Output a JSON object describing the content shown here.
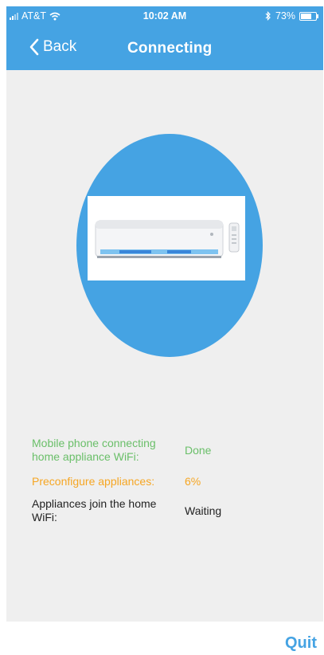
{
  "status_bar": {
    "carrier": "AT&T",
    "time": "10:02 AM",
    "battery": "73%",
    "battery_level": 0.73
  },
  "header": {
    "back_label": "Back",
    "title": "Connecting"
  },
  "steps": [
    {
      "label": "Mobile phone connecting home appliance WiFi:",
      "status": "Done",
      "color": "#6abf69"
    },
    {
      "label": "Preconfigure appliances:",
      "status": "6%",
      "color": "#f6a623"
    },
    {
      "label": "Appliances join the home WiFi:",
      "status": "Waiting",
      "color": "#222222"
    }
  ],
  "footer": {
    "quit_label": "Quit"
  },
  "colors": {
    "accent": "#45a3e3",
    "background": "#efefef",
    "done": "#6abf69",
    "in_progress": "#f6a623"
  },
  "icons": [
    "signal-icon",
    "wifi-icon",
    "bluetooth-icon",
    "battery-icon",
    "chevron-left-icon",
    "air-conditioner-image"
  ]
}
